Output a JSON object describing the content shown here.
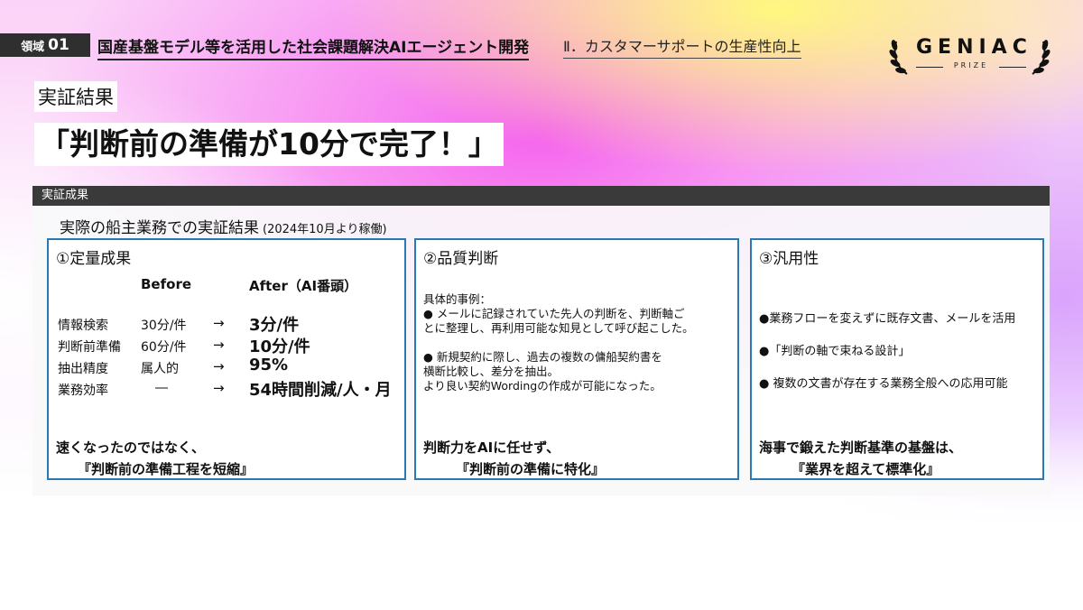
{
  "header": {
    "domain_label": "領域",
    "domain_number": "01",
    "title": "国産基盤モデル等を活用した社会課題解決AIエージェント開発",
    "subtitle": "Ⅱ．カスタマーサポートの生産性向上"
  },
  "logo": {
    "word": "GENIAC",
    "sub": "PRIZE"
  },
  "kicker": "実証結果",
  "main_title": "「判断前の準備が10分で完了！」",
  "section": {
    "bar_label": "実証成果",
    "subtitle": "実際の船主業務での実証結果",
    "subtitle_note": "(2024年10月より稼働)"
  },
  "card1": {
    "title": "①定量成果",
    "header_before": "Before",
    "header_after": "After（AI番頭）",
    "rows": [
      {
        "label": "情報検索",
        "before": "30分/件",
        "arrow": "→",
        "after": "3分/件"
      },
      {
        "label": "判断前準備",
        "before": "60分/件",
        "arrow": "→",
        "after": "10分/件"
      },
      {
        "label": "抽出精度",
        "before": "属人的",
        "arrow": "→",
        "after": "95%"
      },
      {
        "label": "業務効率",
        "before": "―",
        "arrow": "→",
        "after": "54時間削減/人・月"
      }
    ],
    "footer_line1": "速くなったのではなく、",
    "footer_line2": "『判断前の準備工程を短縮』"
  },
  "card2": {
    "title": "②品質判断",
    "lines": [
      "具体的事例：",
      "●  メールに記録されていた先人の判断を、判断軸ご",
      "とに整理し、再利用可能な知見として呼び起こした。",
      "",
      "●  新規契約に際し、過去の複数の傭船契約書を",
      "横断比較し、差分を抽出。",
      "より良い契約Wordingの作成が可能になった。"
    ],
    "footer_line1": "判断力をAIに任せず、",
    "footer_line2": "『判断前の準備に特化』"
  },
  "card3": {
    "title": "③汎用性",
    "items": [
      "●業務フローを変えずに既存文書、メールを活用",
      "●「判断の軸で束ねる設計」",
      "●  複数の文書が存在する業務全般への応用可能"
    ],
    "footer_line1": "海事で鍛えた判断基準の基盤は、",
    "footer_line2": "『業界を超えて標準化』"
  }
}
